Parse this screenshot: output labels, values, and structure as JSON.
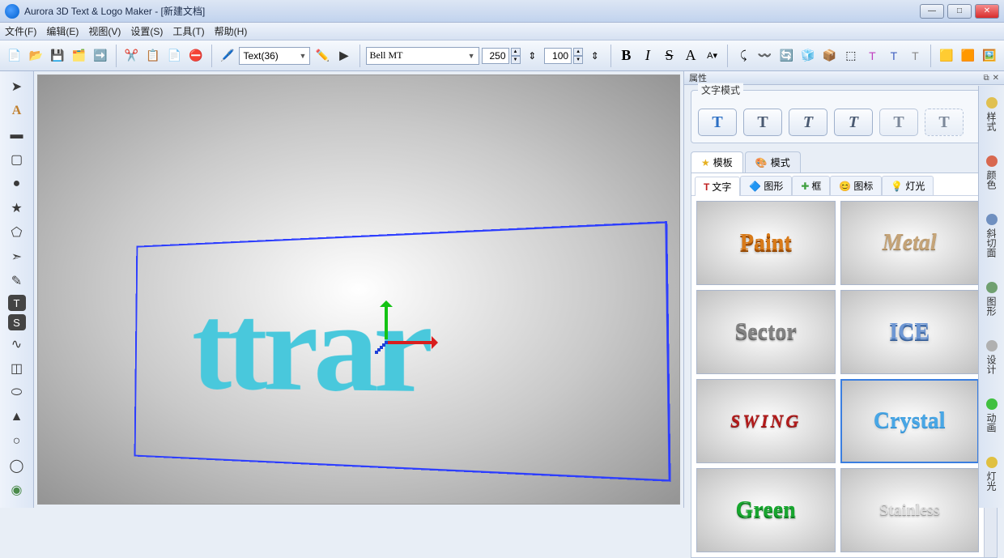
{
  "titlebar": {
    "title": "Aurora 3D Text & Logo Maker - [新建文档]"
  },
  "menu": {
    "file": "文件(F)",
    "edit": "编辑(E)",
    "view": "视图(V)",
    "settings": "设置(S)",
    "tools": "工具(T)",
    "help": "帮助(H)"
  },
  "toolbar": {
    "object_type": "Text(36)",
    "font_name": "Bell MT",
    "width": "250",
    "height": "100",
    "bold": "B",
    "italic": "I",
    "strike": "S",
    "font_a": "A"
  },
  "canvas": {
    "text": "ttrar"
  },
  "right": {
    "panel_title": "属性",
    "text_mode": "文字模式",
    "tab_template": "模板",
    "tab_mode": "模式",
    "sub_text": "文字",
    "sub_shape": "图形",
    "sub_frame": "框",
    "sub_icon": "图标",
    "sub_light": "灯光"
  },
  "presets": {
    "paint": "Paint",
    "metal": "Metal",
    "sector": "Sector",
    "ice": "ICE",
    "swing": "SWING",
    "crystal": "Crystal",
    "green": "Green",
    "stainless": "Stainless"
  },
  "side_tabs": {
    "style": "样式",
    "color": "颜色",
    "bevel": "斜切面",
    "shape": "图形",
    "design": "设计",
    "anim": "动画",
    "light": "灯光"
  }
}
